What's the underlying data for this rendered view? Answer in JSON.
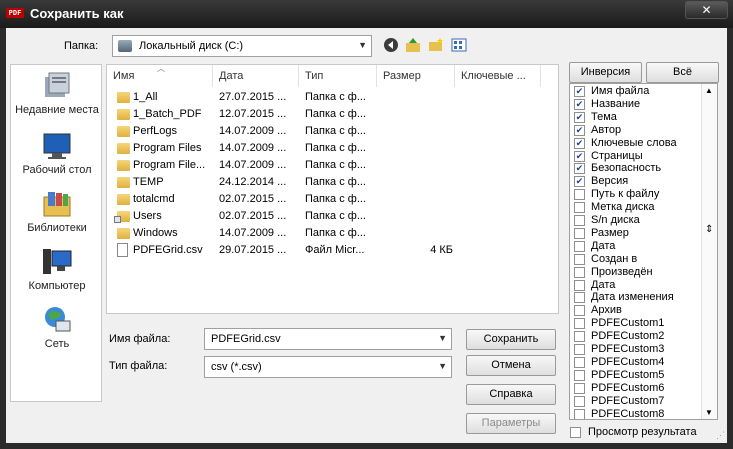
{
  "window": {
    "app_icon": "PDF",
    "title": "Сохранить как",
    "close_symbol": "✕"
  },
  "look_in": {
    "label": "Папка:",
    "value": "Локальный диск (C:)"
  },
  "toolbar_icons": [
    "back-icon",
    "up-folder-icon",
    "new-folder-icon",
    "view-menu-icon"
  ],
  "places": [
    {
      "label": "Недавние места",
      "icon": "recent-places-icon"
    },
    {
      "label": "Рабочий стол",
      "icon": "desktop-icon"
    },
    {
      "label": "Библиотеки",
      "icon": "libraries-icon"
    },
    {
      "label": "Компьютер",
      "icon": "computer-icon"
    },
    {
      "label": "Сеть",
      "icon": "network-icon"
    }
  ],
  "file_list": {
    "columns": [
      "Имя",
      "Дата",
      "Тип",
      "Размер",
      "Ключевые ..."
    ],
    "rows": [
      {
        "name": "1_All",
        "date": "27.07.2015 ...",
        "type": "Папка с ф...",
        "size": "",
        "kind": "folder"
      },
      {
        "name": "1_Batch_PDF",
        "date": "12.07.2015 ...",
        "type": "Папка с ф...",
        "size": "",
        "kind": "folder"
      },
      {
        "name": "PerfLogs",
        "date": "14.07.2009 ...",
        "type": "Папка с ф...",
        "size": "",
        "kind": "folder"
      },
      {
        "name": "Program Files",
        "date": "14.07.2009 ...",
        "type": "Папка с ф...",
        "size": "",
        "kind": "folder"
      },
      {
        "name": "Program File...",
        "date": "14.07.2009 ...",
        "type": "Папка с ф...",
        "size": "",
        "kind": "folder"
      },
      {
        "name": "TEMP",
        "date": "24.12.2014 ...",
        "type": "Папка с ф...",
        "size": "",
        "kind": "folder"
      },
      {
        "name": "totalcmd",
        "date": "02.07.2015 ...",
        "type": "Папка с ф...",
        "size": "",
        "kind": "folder"
      },
      {
        "name": "Users",
        "date": "02.07.2015 ...",
        "type": "Папка с ф...",
        "size": "",
        "kind": "shortcut"
      },
      {
        "name": "Windows",
        "date": "14.07.2009 ...",
        "type": "Папка с ф...",
        "size": "",
        "kind": "folder"
      },
      {
        "name": "PDFEGrid.csv",
        "date": "29.07.2015 ...",
        "type": "Файл Micr...",
        "size": "4 КБ",
        "kind": "file"
      }
    ]
  },
  "file_name": {
    "label": "Имя файла:",
    "value": "PDFEGrid.csv"
  },
  "file_type": {
    "label": "Тип файла:",
    "value": "csv (*.csv)"
  },
  "buttons": {
    "save": "Сохранить",
    "cancel": "Отмена",
    "help": "Справка",
    "params": "Параметры",
    "invert": "Инверсия",
    "all": "Всё"
  },
  "columns_panel": {
    "items": [
      {
        "label": "Имя файла",
        "checked": true
      },
      {
        "label": "Название",
        "checked": true
      },
      {
        "label": "Тема",
        "checked": true
      },
      {
        "label": "Автор",
        "checked": true
      },
      {
        "label": "Ключевые слова",
        "checked": true
      },
      {
        "label": "Страницы",
        "checked": true
      },
      {
        "label": "Безопасность",
        "checked": true
      },
      {
        "label": "Версия",
        "checked": true
      },
      {
        "label": "Путь к файлу",
        "checked": false
      },
      {
        "label": "Метка диска",
        "checked": false
      },
      {
        "label": "S/n диска",
        "checked": false
      },
      {
        "label": "Размер",
        "checked": false
      },
      {
        "label": "Дата",
        "checked": false
      },
      {
        "label": "Создан в",
        "checked": false
      },
      {
        "label": "Произведён",
        "checked": false
      },
      {
        "label": "Дата",
        "checked": false
      },
      {
        "label": "Дата изменения",
        "checked": false
      },
      {
        "label": "Архив",
        "checked": false
      },
      {
        "label": "PDFECustom1",
        "checked": false
      },
      {
        "label": "PDFECustom2",
        "checked": false
      },
      {
        "label": "PDFECustom3",
        "checked": false
      },
      {
        "label": "PDFECustom4",
        "checked": false
      },
      {
        "label": "PDFECustom5",
        "checked": false
      },
      {
        "label": "PDFECustom6",
        "checked": false
      },
      {
        "label": "PDFECustom7",
        "checked": false
      },
      {
        "label": "PDFECustom8",
        "checked": false
      }
    ]
  },
  "preview": {
    "label": "Просмотр результата",
    "checked": false
  },
  "colors": {
    "titlebar": "#1a1a1a",
    "client": "#f0f0f0",
    "check": "#1a3fa0"
  }
}
